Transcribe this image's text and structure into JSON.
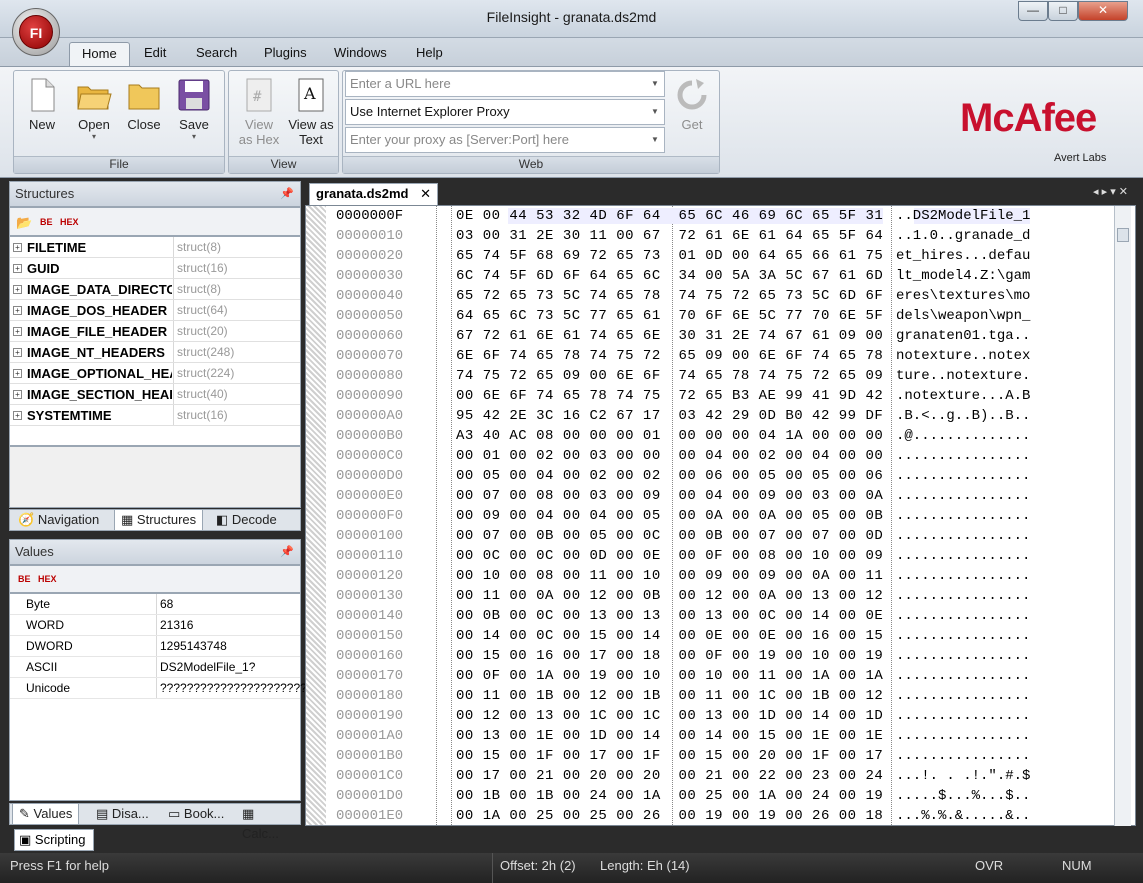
{
  "window": {
    "title": "FileInsight - granata.ds2md",
    "app_badge": "FI",
    "min": "—",
    "max": "□",
    "close": "✕"
  },
  "menu": [
    "Home",
    "Edit",
    "Search",
    "Plugins",
    "Windows",
    "Help"
  ],
  "ribbon": {
    "file_group": {
      "caption": "File",
      "new": "New",
      "open": "Open",
      "close": "Close",
      "save": "Save"
    },
    "view_group": {
      "caption": "View",
      "view_hex_1": "View",
      "view_hex_2": "as Hex",
      "view_text_1": "View as",
      "view_text_2": "Text"
    },
    "web_group": {
      "caption": "Web",
      "url_placeholder": "Enter a URL here",
      "proxy_option": "Use Internet Explorer Proxy",
      "proxy_placeholder": "Enter your proxy as [Server:Port] here",
      "get": "Get"
    },
    "logo": "McAfee",
    "logo_sub": "Avert Labs"
  },
  "structures": {
    "title": "Structures",
    "items": [
      {
        "name": "FILETIME",
        "type": "struct(8)"
      },
      {
        "name": "GUID",
        "type": "struct(16)"
      },
      {
        "name": "IMAGE_DATA_DIRECTO",
        "type": "struct(8)"
      },
      {
        "name": "IMAGE_DOS_HEADER",
        "type": "struct(64)"
      },
      {
        "name": "IMAGE_FILE_HEADER",
        "type": "struct(20)"
      },
      {
        "name": "IMAGE_NT_HEADERS",
        "type": "struct(248)"
      },
      {
        "name": "IMAGE_OPTIONAL_HEA",
        "type": "struct(224)"
      },
      {
        "name": "IMAGE_SECTION_HEADI",
        "type": "struct(40)"
      },
      {
        "name": "SYSTEMTIME",
        "type": "struct(16)"
      }
    ],
    "tabs": [
      "Navigation",
      "Structures",
      "Decode"
    ]
  },
  "values": {
    "title": "Values",
    "rows": [
      {
        "k": "Byte",
        "v": "68"
      },
      {
        "k": "WORD",
        "v": "21316"
      },
      {
        "k": "DWORD",
        "v": "1295143748"
      },
      {
        "k": "ASCII",
        "v": "DS2ModelFile_1?"
      },
      {
        "k": "Unicode",
        "v": "??????????????????????????"
      }
    ],
    "tabs": [
      "Values",
      "Disa...",
      "Book...",
      "Calc..."
    ]
  },
  "doc_tab": "granata.ds2md",
  "hex": [
    {
      "o": "0000000F",
      "h": "0E 00 44 53 32 4D 6F 64  65 6C 46 69 6C 65 5F 31",
      "a": "..DS2ModelFile_1"
    },
    {
      "o": "00000010",
      "h": "03 00 31 2E 30 11 00 67  72 61 6E 61 64 65 5F 64",
      "a": "..1.0..granade_d"
    },
    {
      "o": "00000020",
      "h": "65 74 5F 68 69 72 65 73  01 0D 00 64 65 66 61 75",
      "a": "et_hires...defau"
    },
    {
      "o": "00000030",
      "h": "6C 74 5F 6D 6F 64 65 6C  34 00 5A 3A 5C 67 61 6D",
      "a": "lt_model4.Z:\\gam"
    },
    {
      "o": "00000040",
      "h": "65 72 65 73 5C 74 65 78  74 75 72 65 73 5C 6D 6F",
      "a": "eres\\textures\\mo"
    },
    {
      "o": "00000050",
      "h": "64 65 6C 73 5C 77 65 61  70 6F 6E 5C 77 70 6E 5F",
      "a": "dels\\weapon\\wpn_"
    },
    {
      "o": "00000060",
      "h": "67 72 61 6E 61 74 65 6E  30 31 2E 74 67 61 09 00",
      "a": "granaten01.tga.."
    },
    {
      "o": "00000070",
      "h": "6E 6F 74 65 78 74 75 72  65 09 00 6E 6F 74 65 78",
      "a": "notexture..notex"
    },
    {
      "o": "00000080",
      "h": "74 75 72 65 09 00 6E 6F  74 65 78 74 75 72 65 09",
      "a": "ture..notexture."
    },
    {
      "o": "00000090",
      "h": "00 6E 6F 74 65 78 74 75  72 65 B3 AE 99 41 9D 42",
      "a": ".notexture...A.B"
    },
    {
      "o": "000000A0",
      "h": "95 42 2E 3C 16 C2 67 17  03 42 29 0D B0 42 99 DF",
      "a": ".B.<..g..B)..B.."
    },
    {
      "o": "000000B0",
      "h": "A3 40 AC 08 00 00 00 01  00 00 00 04 1A 00 00 00",
      "a": ".@.............."
    },
    {
      "o": "000000C0",
      "h": "00 01 00 02 00 03 00 00  00 04 00 02 00 04 00 00",
      "a": "................"
    },
    {
      "o": "000000D0",
      "h": "00 05 00 04 00 02 00 02  00 06 00 05 00 05 00 06",
      "a": "................"
    },
    {
      "o": "000000E0",
      "h": "00 07 00 08 00 03 00 09  00 04 00 09 00 03 00 0A",
      "a": "................"
    },
    {
      "o": "000000F0",
      "h": "00 09 00 04 00 04 00 05  00 0A 00 0A 00 05 00 0B",
      "a": "................"
    },
    {
      "o": "00000100",
      "h": "00 07 00 0B 00 05 00 0C  00 0B 00 07 00 07 00 0D",
      "a": "................"
    },
    {
      "o": "00000110",
      "h": "00 0C 00 0C 00 0D 00 0E  00 0F 00 08 00 10 00 09",
      "a": "................"
    },
    {
      "o": "00000120",
      "h": "00 10 00 08 00 11 00 10  00 09 00 09 00 0A 00 11",
      "a": "................"
    },
    {
      "o": "00000130",
      "h": "00 11 00 0A 00 12 00 0B  00 12 00 0A 00 13 00 12",
      "a": "................"
    },
    {
      "o": "00000140",
      "h": "00 0B 00 0C 00 13 00 13  00 13 00 0C 00 14 00 0E",
      "a": "................"
    },
    {
      "o": "00000150",
      "h": "00 14 00 0C 00 15 00 14  00 0E 00 0E 00 16 00 15",
      "a": "................"
    },
    {
      "o": "00000160",
      "h": "00 15 00 16 00 17 00 18  00 0F 00 19 00 10 00 19",
      "a": "................"
    },
    {
      "o": "00000170",
      "h": "00 0F 00 1A 00 19 00 10  00 10 00 11 00 1A 00 1A",
      "a": "................"
    },
    {
      "o": "00000180",
      "h": "00 11 00 1B 00 12 00 1B  00 11 00 1C 00 1B 00 12",
      "a": "................"
    },
    {
      "o": "00000190",
      "h": "00 12 00 13 00 1C 00 1C  00 13 00 1D 00 14 00 1D",
      "a": "................"
    },
    {
      "o": "000001A0",
      "h": "00 13 00 1E 00 1D 00 14  00 14 00 15 00 1E 00 1E",
      "a": "................"
    },
    {
      "o": "000001B0",
      "h": "00 15 00 1F 00 17 00 1F  00 15 00 20 00 1F 00 17",
      "a": "................"
    },
    {
      "o": "000001C0",
      "h": "00 17 00 21 00 20 00 20  00 21 00 22 00 23 00 24",
      "a": "...!. . .!.\".#.$"
    },
    {
      "o": "000001D0",
      "h": "00 1B 00 1B 00 24 00 1A  00 25 00 1A 00 24 00 19",
      "a": ".....$...%...$.."
    },
    {
      "o": "000001E0",
      "h": "00 1A 00 25 00 25 00 26  00 19 00 19 00 26 00 18",
      "a": "...%.%.&.....&.."
    }
  ],
  "scripting_tab": "Scripting",
  "status": {
    "help": "Press F1 for help",
    "offset": "Offset: 2h (2)",
    "length": "Length: Eh (14)",
    "ovr": "OVR",
    "num": "NUM"
  }
}
